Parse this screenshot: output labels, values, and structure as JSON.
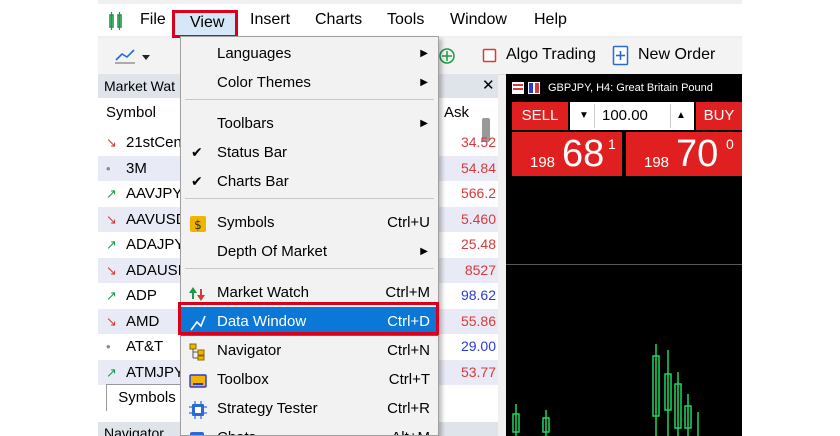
{
  "menubar": {
    "items": [
      "File",
      "View",
      "Insert",
      "Charts",
      "Tools",
      "Window",
      "Help"
    ]
  },
  "toolbar": {
    "algo_trading": "Algo Trading",
    "new_order": "New Order"
  },
  "market_watch": {
    "title": "Market Wat",
    "col_symbol": "Symbol",
    "col_ask": "Ask",
    "tab": "Symbols",
    "rows": [
      {
        "name": "21stCen",
        "ask": "34.52",
        "dir": "↘",
        "dir_color": "#d63a3a",
        "ask_color": "#d63a3a"
      },
      {
        "name": "3M",
        "ask": "54.84",
        "dir": "•",
        "dir_color": "#8a8a8a",
        "ask_color": "#d63a3a"
      },
      {
        "name": "AAVJPY",
        "ask": "566.2",
        "dir": "↗",
        "dir_color": "#1a9a4a",
        "ask_color": "#d63a3a"
      },
      {
        "name": "AAVUSD",
        "ask": "5.460",
        "dir": "↘",
        "dir_color": "#d63a3a",
        "ask_color": "#d63a3a"
      },
      {
        "name": "ADAJPY",
        "ask": "25.48",
        "dir": "↗",
        "dir_color": "#1a9a4a",
        "ask_color": "#d63a3a"
      },
      {
        "name": "ADAUSI",
        "ask": "8527",
        "dir": "↘",
        "dir_color": "#d63a3a",
        "ask_color": "#d63a3a"
      },
      {
        "name": "ADP",
        "ask": "98.62",
        "dir": "↗",
        "dir_color": "#1a9a4a",
        "ask_color": "#2a3ad6"
      },
      {
        "name": "AMD",
        "ask": "55.86",
        "dir": "↘",
        "dir_color": "#d63a3a",
        "ask_color": "#d63a3a"
      },
      {
        "name": "AT&T",
        "ask": "29.00",
        "dir": "•",
        "dir_color": "#8a8a8a",
        "ask_color": "#2a3ad6"
      },
      {
        "name": "ATMJPY",
        "ask": "53.77",
        "dir": "↗",
        "dir_color": "#1a9a4a",
        "ask_color": "#d63a3a"
      }
    ],
    "navigator_title": "Navigator"
  },
  "chart": {
    "title": "GBPJPY, H4:  Great Britain Pound",
    "sell": "SELL",
    "buy": "BUY",
    "lot": "100.00",
    "sell_price_small": "198",
    "sell_price_big": "68",
    "sell_price_sup": "1",
    "buy_price_small": "198",
    "buy_price_big": "70",
    "buy_price_sup": "0"
  },
  "view_menu": {
    "items": [
      {
        "label": "Languages",
        "shortcut": "",
        "submenu": true
      },
      {
        "label": "Color Themes",
        "shortcut": "",
        "submenu": true
      },
      {
        "label": "Toolbars",
        "shortcut": "",
        "submenu": true
      },
      {
        "label": "Status Bar",
        "shortcut": "",
        "checked": true
      },
      {
        "label": "Charts Bar",
        "shortcut": "",
        "checked": true
      },
      {
        "label": "Symbols",
        "shortcut": "Ctrl+U",
        "icon": "symbols-icon"
      },
      {
        "label": "Depth Of Market",
        "shortcut": "",
        "submenu": true
      },
      {
        "label": "Market Watch",
        "shortcut": "Ctrl+M",
        "icon": "market-watch-icon"
      },
      {
        "label": "Data Window",
        "shortcut": "Ctrl+D",
        "icon": "data-window-icon",
        "highlighted": true
      },
      {
        "label": "Navigator",
        "shortcut": "Ctrl+N",
        "icon": "navigator-icon"
      },
      {
        "label": "Toolbox",
        "shortcut": "Ctrl+T",
        "icon": "toolbox-icon"
      },
      {
        "label": "Strategy Tester",
        "shortcut": "Ctrl+R",
        "icon": "strategy-tester-icon"
      },
      {
        "label": "Chats",
        "shortcut": "Alt+M",
        "icon": "chats-icon"
      }
    ]
  },
  "colors": {
    "highlight": "#0b78d7",
    "annotation": "#d9001b",
    "sell_buy": "#e02020"
  }
}
